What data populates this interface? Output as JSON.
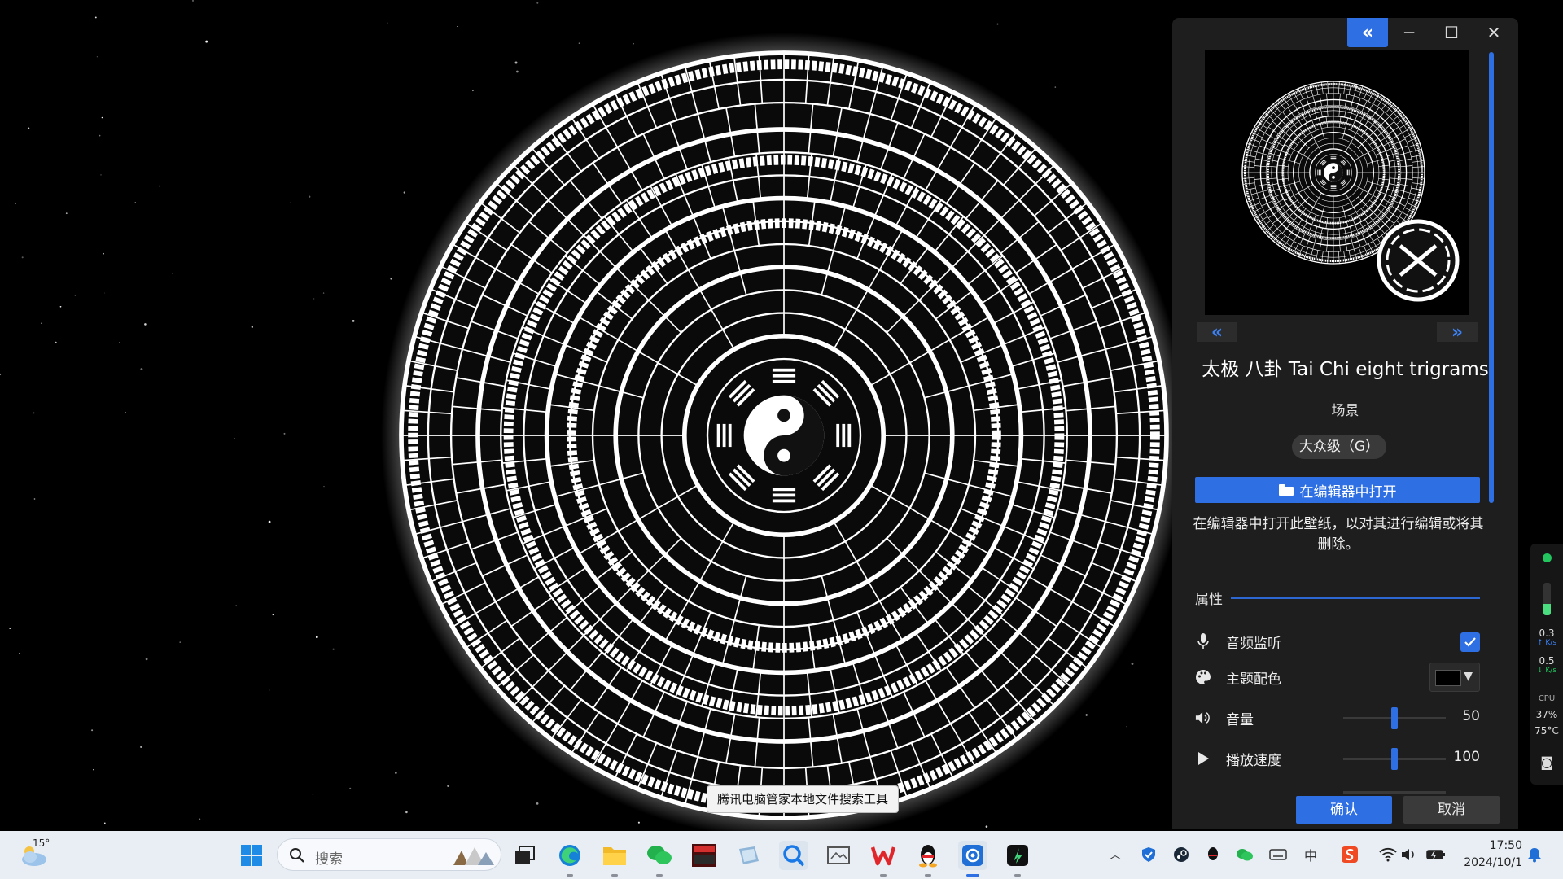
{
  "colors": {
    "accent": "#2f6fe4",
    "panel_bg": "#1e1e1e",
    "taskbar_bg": "#e9eef5"
  },
  "tooltip": "腾讯电脑管家本地文件搜索工具",
  "panel": {
    "title": "太极 八卦 Tai Chi eight trigrams",
    "type": "场景",
    "rating": "大众级（G）",
    "open_button": "在编辑器中打开",
    "description": "在编辑器中打开此壁纸，以对其进行编辑或将其删除。",
    "section": "属性",
    "properties": [
      {
        "label": "音频监听",
        "control": "checkbox",
        "checked": true,
        "icon": "microphone-icon"
      },
      {
        "label": "主题配色",
        "control": "color",
        "value": "#000000",
        "icon": "palette-icon"
      },
      {
        "label": "音量",
        "control": "slider",
        "value": "50",
        "icon": "speaker-icon"
      },
      {
        "label": "播放速度",
        "control": "slider",
        "value": "100",
        "icon": "play-icon"
      }
    ],
    "confirm": "确认",
    "cancel": "取消"
  },
  "monitor": {
    "upload_value": "0.3",
    "upload_unit": "K/s",
    "download_value": "0.5",
    "download_unit": "K/s",
    "cpu_label": "CPU",
    "cpu_usage": "37%",
    "cpu_temp": "75°C"
  },
  "taskbar": {
    "weather_temp": "15°",
    "search_placeholder": "搜索",
    "apps": [
      "start-icon",
      "search-box",
      "task-view-icon",
      "edge-icon",
      "file-explorer-icon",
      "wechat-icon",
      "voicemeeter-icon",
      "tablet-icon",
      "file-search-icon",
      "screenshot-icon",
      "wps-icon",
      "qq-icon",
      "settings-app-icon",
      "gpu-app-icon"
    ],
    "tray_icons": [
      "chevron-up-icon",
      "shield-icon",
      "steam-icon",
      "qq-tray-icon",
      "wechat-tray-icon",
      "keyboard-icon",
      "ime-icon",
      "sogou-icon",
      "wifi-icon",
      "volume-icon",
      "battery-icon"
    ],
    "time": "17:50",
    "date": "2024/10/1"
  }
}
